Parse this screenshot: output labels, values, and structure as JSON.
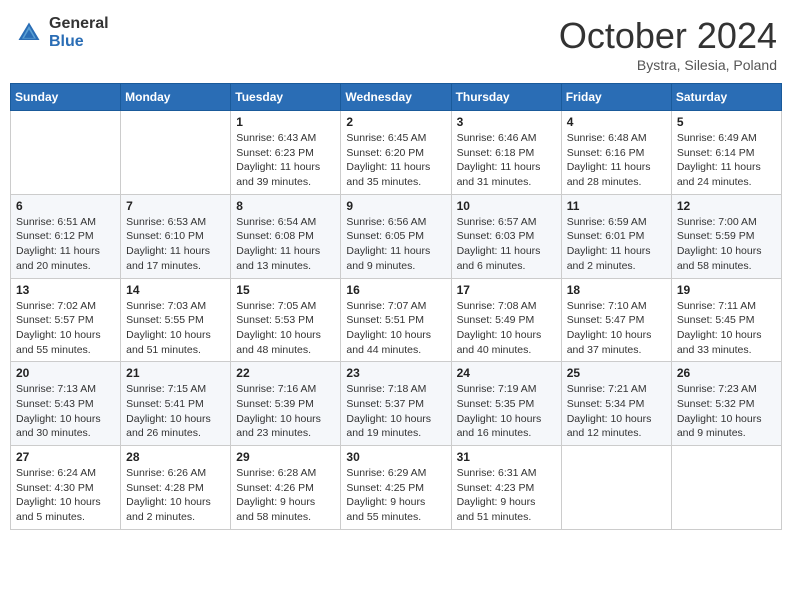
{
  "logo": {
    "general": "General",
    "blue": "Blue"
  },
  "header": {
    "month": "October 2024",
    "location": "Bystra, Silesia, Poland"
  },
  "weekdays": [
    "Sunday",
    "Monday",
    "Tuesday",
    "Wednesday",
    "Thursday",
    "Friday",
    "Saturday"
  ],
  "weeks": [
    [
      {
        "day": "",
        "info": ""
      },
      {
        "day": "",
        "info": ""
      },
      {
        "day": "1",
        "info": "Sunrise: 6:43 AM\nSunset: 6:23 PM\nDaylight: 11 hours and 39 minutes."
      },
      {
        "day": "2",
        "info": "Sunrise: 6:45 AM\nSunset: 6:20 PM\nDaylight: 11 hours and 35 minutes."
      },
      {
        "day": "3",
        "info": "Sunrise: 6:46 AM\nSunset: 6:18 PM\nDaylight: 11 hours and 31 minutes."
      },
      {
        "day": "4",
        "info": "Sunrise: 6:48 AM\nSunset: 6:16 PM\nDaylight: 11 hours and 28 minutes."
      },
      {
        "day": "5",
        "info": "Sunrise: 6:49 AM\nSunset: 6:14 PM\nDaylight: 11 hours and 24 minutes."
      }
    ],
    [
      {
        "day": "6",
        "info": "Sunrise: 6:51 AM\nSunset: 6:12 PM\nDaylight: 11 hours and 20 minutes."
      },
      {
        "day": "7",
        "info": "Sunrise: 6:53 AM\nSunset: 6:10 PM\nDaylight: 11 hours and 17 minutes."
      },
      {
        "day": "8",
        "info": "Sunrise: 6:54 AM\nSunset: 6:08 PM\nDaylight: 11 hours and 13 minutes."
      },
      {
        "day": "9",
        "info": "Sunrise: 6:56 AM\nSunset: 6:05 PM\nDaylight: 11 hours and 9 minutes."
      },
      {
        "day": "10",
        "info": "Sunrise: 6:57 AM\nSunset: 6:03 PM\nDaylight: 11 hours and 6 minutes."
      },
      {
        "day": "11",
        "info": "Sunrise: 6:59 AM\nSunset: 6:01 PM\nDaylight: 11 hours and 2 minutes."
      },
      {
        "day": "12",
        "info": "Sunrise: 7:00 AM\nSunset: 5:59 PM\nDaylight: 10 hours and 58 minutes."
      }
    ],
    [
      {
        "day": "13",
        "info": "Sunrise: 7:02 AM\nSunset: 5:57 PM\nDaylight: 10 hours and 55 minutes."
      },
      {
        "day": "14",
        "info": "Sunrise: 7:03 AM\nSunset: 5:55 PM\nDaylight: 10 hours and 51 minutes."
      },
      {
        "day": "15",
        "info": "Sunrise: 7:05 AM\nSunset: 5:53 PM\nDaylight: 10 hours and 48 minutes."
      },
      {
        "day": "16",
        "info": "Sunrise: 7:07 AM\nSunset: 5:51 PM\nDaylight: 10 hours and 44 minutes."
      },
      {
        "day": "17",
        "info": "Sunrise: 7:08 AM\nSunset: 5:49 PM\nDaylight: 10 hours and 40 minutes."
      },
      {
        "day": "18",
        "info": "Sunrise: 7:10 AM\nSunset: 5:47 PM\nDaylight: 10 hours and 37 minutes."
      },
      {
        "day": "19",
        "info": "Sunrise: 7:11 AM\nSunset: 5:45 PM\nDaylight: 10 hours and 33 minutes."
      }
    ],
    [
      {
        "day": "20",
        "info": "Sunrise: 7:13 AM\nSunset: 5:43 PM\nDaylight: 10 hours and 30 minutes."
      },
      {
        "day": "21",
        "info": "Sunrise: 7:15 AM\nSunset: 5:41 PM\nDaylight: 10 hours and 26 minutes."
      },
      {
        "day": "22",
        "info": "Sunrise: 7:16 AM\nSunset: 5:39 PM\nDaylight: 10 hours and 23 minutes."
      },
      {
        "day": "23",
        "info": "Sunrise: 7:18 AM\nSunset: 5:37 PM\nDaylight: 10 hours and 19 minutes."
      },
      {
        "day": "24",
        "info": "Sunrise: 7:19 AM\nSunset: 5:35 PM\nDaylight: 10 hours and 16 minutes."
      },
      {
        "day": "25",
        "info": "Sunrise: 7:21 AM\nSunset: 5:34 PM\nDaylight: 10 hours and 12 minutes."
      },
      {
        "day": "26",
        "info": "Sunrise: 7:23 AM\nSunset: 5:32 PM\nDaylight: 10 hours and 9 minutes."
      }
    ],
    [
      {
        "day": "27",
        "info": "Sunrise: 6:24 AM\nSunset: 4:30 PM\nDaylight: 10 hours and 5 minutes."
      },
      {
        "day": "28",
        "info": "Sunrise: 6:26 AM\nSunset: 4:28 PM\nDaylight: 10 hours and 2 minutes."
      },
      {
        "day": "29",
        "info": "Sunrise: 6:28 AM\nSunset: 4:26 PM\nDaylight: 9 hours and 58 minutes."
      },
      {
        "day": "30",
        "info": "Sunrise: 6:29 AM\nSunset: 4:25 PM\nDaylight: 9 hours and 55 minutes."
      },
      {
        "day": "31",
        "info": "Sunrise: 6:31 AM\nSunset: 4:23 PM\nDaylight: 9 hours and 51 minutes."
      },
      {
        "day": "",
        "info": ""
      },
      {
        "day": "",
        "info": ""
      }
    ]
  ]
}
